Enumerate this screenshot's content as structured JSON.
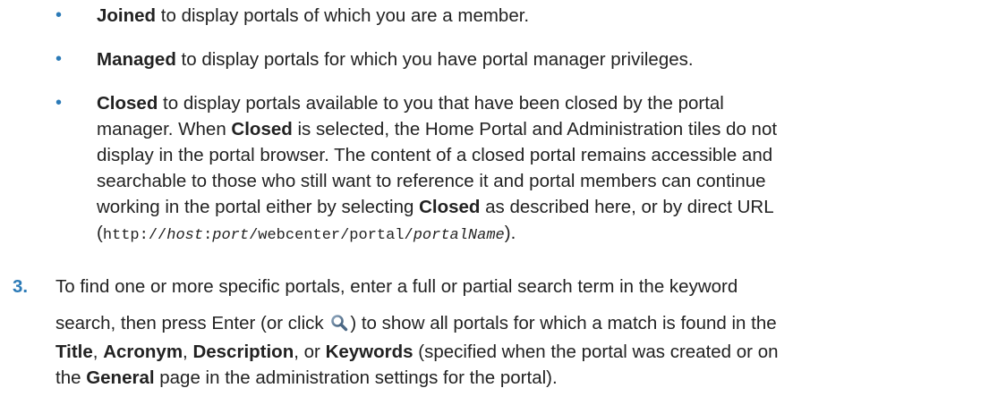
{
  "bullets": [
    {
      "marker": "•",
      "term": "Joined",
      "rest": " to display portals of which you are a member."
    },
    {
      "marker": "•",
      "term": "Managed",
      "rest": " to display portals for which you have portal manager privileges."
    }
  ],
  "closed": {
    "marker": "•",
    "line1_term": "Closed",
    "line1_rest": " to display portals available to you that have been closed by the portal",
    "line2_a": "manager. When ",
    "line2_term": "Closed",
    "line2_b": " is selected, the Home Portal and Administration tiles do not",
    "line3": "display in the portal browser. The content of a closed portal remains accessible and",
    "line4": "searchable to those who still want to reference it and portal members can continue",
    "line5_a": "working in the portal either by selecting ",
    "line5_term": "Closed",
    "line5_b": " as described here, or by direct URL",
    "url_open": "(",
    "url_p1": "http://",
    "url_host": "host",
    "url_colon": ":",
    "url_port": "port",
    "url_p2": "/webcenter/portal/",
    "url_name": "portalName",
    "url_close": ")."
  },
  "step3": {
    "number": "3.",
    "line1": "To find one or more specific portals, enter a full or partial search term in the keyword",
    "line2_a": "search, then press Enter (or click ",
    "line2_b": ") to show all portals for which a match is found in the",
    "line3_title": "Title",
    "line3_c1": ", ",
    "line3_acronym": "Acronym",
    "line3_c2": ", ",
    "line3_desc": "Description",
    "line3_c3": ", or ",
    "line3_keywords": "Keywords",
    "line3_rest": " (specified when the portal was created or on",
    "line4_a": "the ",
    "line4_general": "General",
    "line4_b": " page in the administration settings for the portal).",
    "icon": "search-icon"
  }
}
